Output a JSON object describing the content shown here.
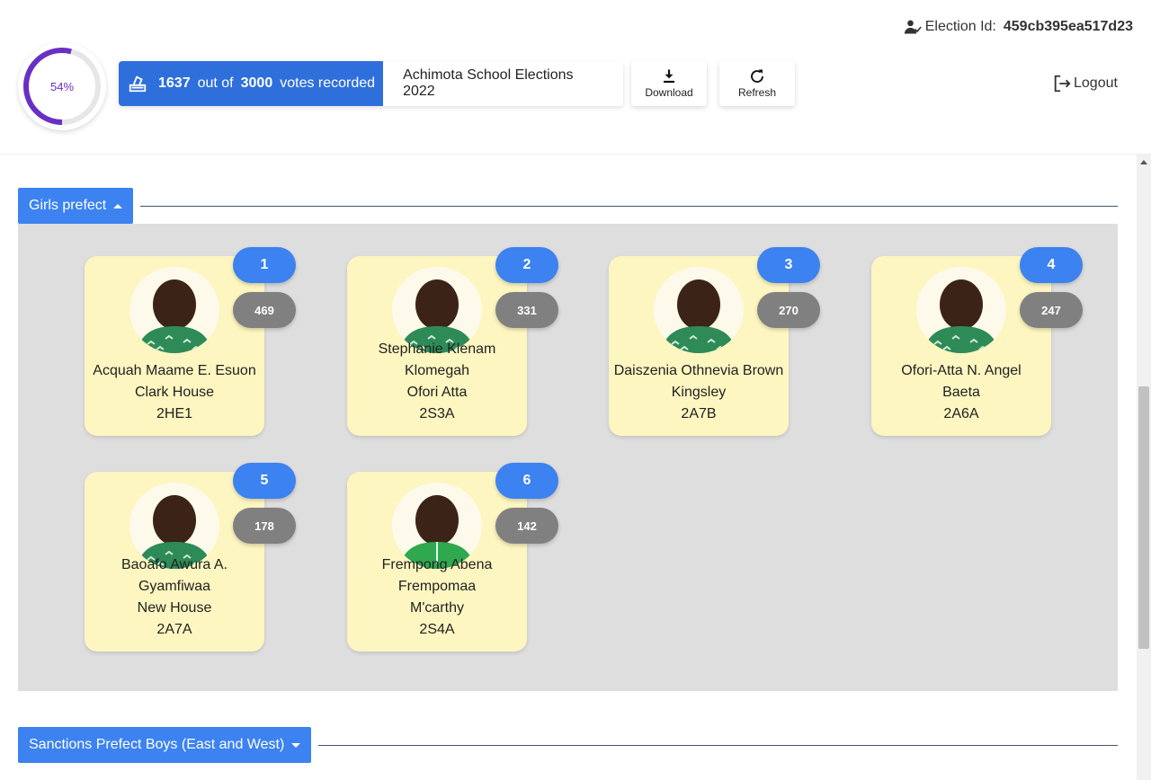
{
  "header": {
    "election_id_label": "Election Id:",
    "election_id": "459cb395ea517d23",
    "progress_percent": 54,
    "progress_label": "54%",
    "votes_cast": "1637",
    "out_of_label": "out of",
    "votes_total": "3000",
    "votes_suffix": "votes recorded",
    "election_name": "Achimota School Elections 2022",
    "download_label": "Download",
    "refresh_label": "Refresh",
    "logout_label": "Logout"
  },
  "colors": {
    "primary": "#3c82f0",
    "votes_box": "#2f6fdb",
    "progress": "#6a2fc4",
    "card": "#fdf6c0",
    "count_badge": "#808080",
    "panel": "#dedede"
  },
  "sections": [
    {
      "title": "Girls prefect",
      "expanded": true,
      "candidates": [
        {
          "rank": "1",
          "votes": "469",
          "lines": [
            "Acquah Maame E. Esuon",
            "Clark House",
            "2HE1"
          ],
          "outfit": "green-print"
        },
        {
          "rank": "2",
          "votes": "331",
          "lines": [
            "Stephanie Klenam",
            "Klomegah",
            "Ofori Atta",
            "2S3A"
          ],
          "outfit": "green-print"
        },
        {
          "rank": "3",
          "votes": "270",
          "lines": [
            "Daiszenia Othnevia Brown",
            "Kingsley",
            "2A7B"
          ],
          "outfit": "green-print"
        },
        {
          "rank": "4",
          "votes": "247",
          "lines": [
            "Ofori-Atta N. Angel",
            "Baeta",
            "2A6A"
          ],
          "outfit": "green-print"
        },
        {
          "rank": "5",
          "votes": "178",
          "lines": [
            "Baoafo Awura A.",
            "Gyamfiwaa",
            "New House",
            "2A7A"
          ],
          "outfit": "green-print"
        },
        {
          "rank": "6",
          "votes": "142",
          "lines": [
            "Frempong Abena",
            "Frempomaa",
            "M'carthy",
            "2S4A"
          ],
          "outfit": "green-shirt"
        }
      ]
    },
    {
      "title": "Sanctions Prefect Boys (East and West)",
      "expanded": false,
      "candidates": []
    }
  ]
}
